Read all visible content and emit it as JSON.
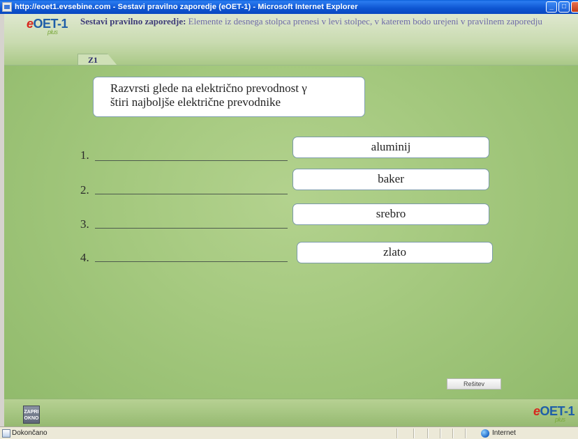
{
  "window": {
    "title": "http://eoet1.evsebine.com - Sestavi pravilno zaporedje (eOET-1) - Microsoft Internet Explorer",
    "buttons": {
      "minimize": "_",
      "maximize": "□"
    }
  },
  "header": {
    "logo": {
      "prefix": "e",
      "name": "OET-1",
      "plus": "plus"
    },
    "instruction_bold": "Sestavi pravilno zaporedje:",
    "instruction_text": " Elemente iz desnega stolpca prenesi v levi stolpec, v katerem bodo urejeni v pravilnem zaporedju",
    "tab_label": "Z1"
  },
  "question": {
    "line1": "Razvrsti glede na električno prevodnost γ",
    "line2": "štiri najboljše električne prevodnike"
  },
  "slots": [
    {
      "label": "1."
    },
    {
      "label": "2."
    },
    {
      "label": "3."
    },
    {
      "label": "4."
    }
  ],
  "answers": [
    {
      "label": "aluminij"
    },
    {
      "label": "baker"
    },
    {
      "label": "srebro"
    },
    {
      "label": "zlato"
    }
  ],
  "solution_button": "Rešitev",
  "footer": {
    "close_button_line1": "ZAPRI",
    "close_button_line2": "OKNO",
    "logo": {
      "prefix": "e",
      "name": "OET-1",
      "plus": "plus"
    }
  },
  "statusbar": {
    "status": "Dokončano",
    "zone": "Internet"
  }
}
